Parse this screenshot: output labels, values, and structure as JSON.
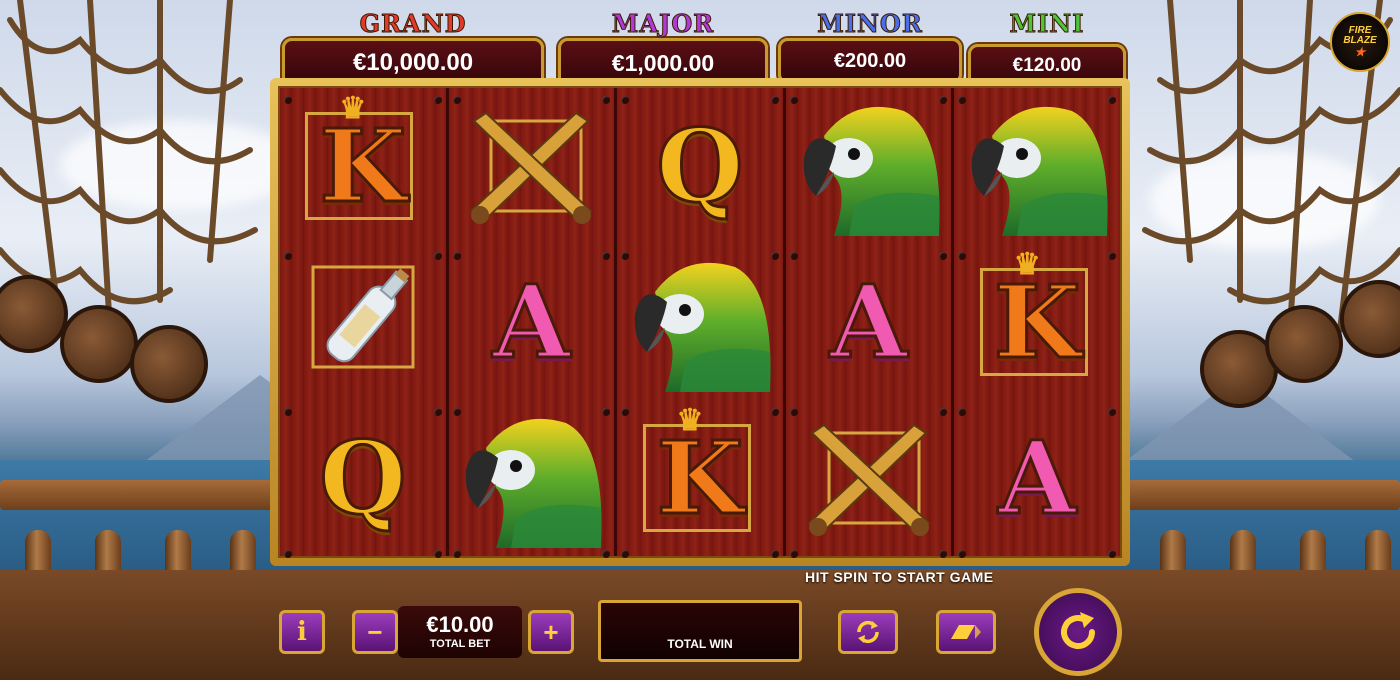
{
  "jackpots": [
    {
      "name": "GRAND",
      "amount": "€10,000.00"
    },
    {
      "name": "MAJOR",
      "amount": "€1,000.00"
    },
    {
      "name": "MINOR",
      "amount": "€200.00"
    },
    {
      "name": "MINI",
      "amount": "€120.00"
    }
  ],
  "logo": {
    "line1": "FIRE",
    "line2": "BLAZE",
    "mark": "★"
  },
  "reels": [
    [
      "K",
      "bottle",
      "Q"
    ],
    [
      "pistols",
      "A",
      "parrot"
    ],
    [
      "Q",
      "parrot",
      "K"
    ],
    [
      "parrot",
      "A",
      "pistols"
    ],
    [
      "parrot",
      "K",
      "A"
    ]
  ],
  "status": "HIT SPIN TO START GAME",
  "controls": {
    "info_label": "i",
    "minus_label": "−",
    "plus_label": "+",
    "bet_value": "€10.00",
    "bet_label": "TOTAL BET",
    "win_label": "TOTAL WIN",
    "autoplay_icon": "autoplay-icon",
    "turbo_icon": "turbo-icon",
    "spin_icon": "spin-icon"
  }
}
